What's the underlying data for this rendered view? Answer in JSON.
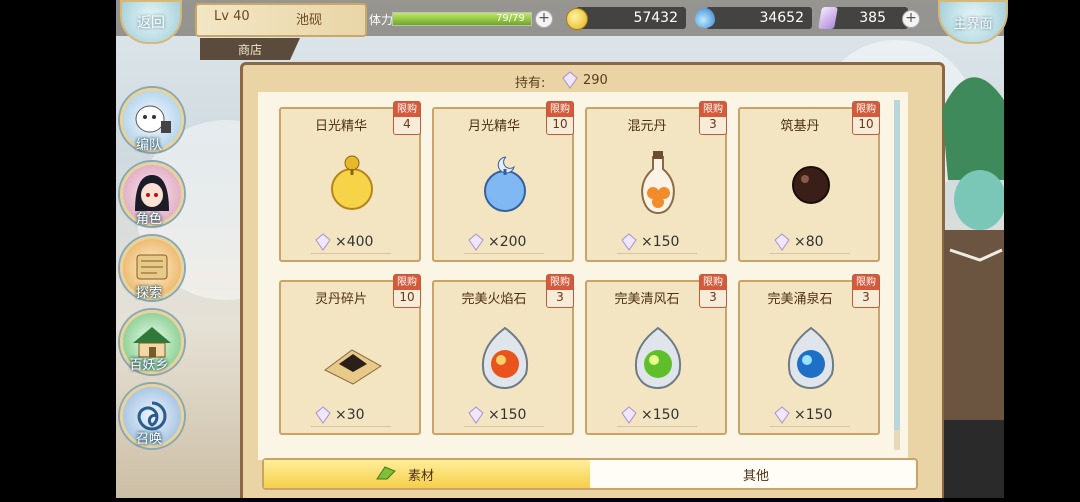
{
  "topbar": {
    "back_label": "返回",
    "level": "Lv 40",
    "player_name": "池砚",
    "stamina_label": "体力",
    "stamina_value": "79/79",
    "stamina_fraction": 1.0,
    "gold": "57432",
    "spirit": "34652",
    "crystal": "385",
    "main_menu_label": "主界面"
  },
  "breadcrumb": "商店",
  "side_menu": [
    {
      "label": "编队",
      "icon": "cat-ghost-icon"
    },
    {
      "label": "角色",
      "icon": "character-portrait-icon"
    },
    {
      "label": "探索",
      "icon": "scroll-explore-icon"
    },
    {
      "label": "百妖乡",
      "icon": "village-house-icon"
    },
    {
      "label": "召唤",
      "icon": "summon-swirl-icon"
    }
  ],
  "shop": {
    "holding_label": "持有:",
    "holding_value": "290",
    "limit_label": "限购",
    "items": [
      {
        "name": "日光精华",
        "limit": "4",
        "price": "×400",
        "icon": "sun-essence-icon"
      },
      {
        "name": "月光精华",
        "limit": "10",
        "price": "×200",
        "icon": "moon-essence-icon"
      },
      {
        "name": "混元丹",
        "limit": "3",
        "price": "×150",
        "icon": "pill-bottle-icon"
      },
      {
        "name": "筑基丹",
        "limit": "10",
        "price": "×80",
        "icon": "dark-pill-icon"
      },
      {
        "name": "灵丹碎片",
        "limit": "10",
        "price": "×30",
        "icon": "pill-shard-icon"
      },
      {
        "name": "完美火焰石",
        "limit": "3",
        "price": "×150",
        "icon": "fire-stone-icon"
      },
      {
        "name": "完美清风石",
        "limit": "3",
        "price": "×150",
        "icon": "wind-stone-icon"
      },
      {
        "name": "完美涌泉石",
        "limit": "3",
        "price": "×150",
        "icon": "spring-stone-icon"
      }
    ]
  },
  "tabs": [
    {
      "label": "素材",
      "active": true
    },
    {
      "label": "其他",
      "active": false
    }
  ],
  "colors": {
    "limit_badge": "#d35a3a",
    "tab_active": "#f6cf4a",
    "panel": "#ead4a5"
  }
}
